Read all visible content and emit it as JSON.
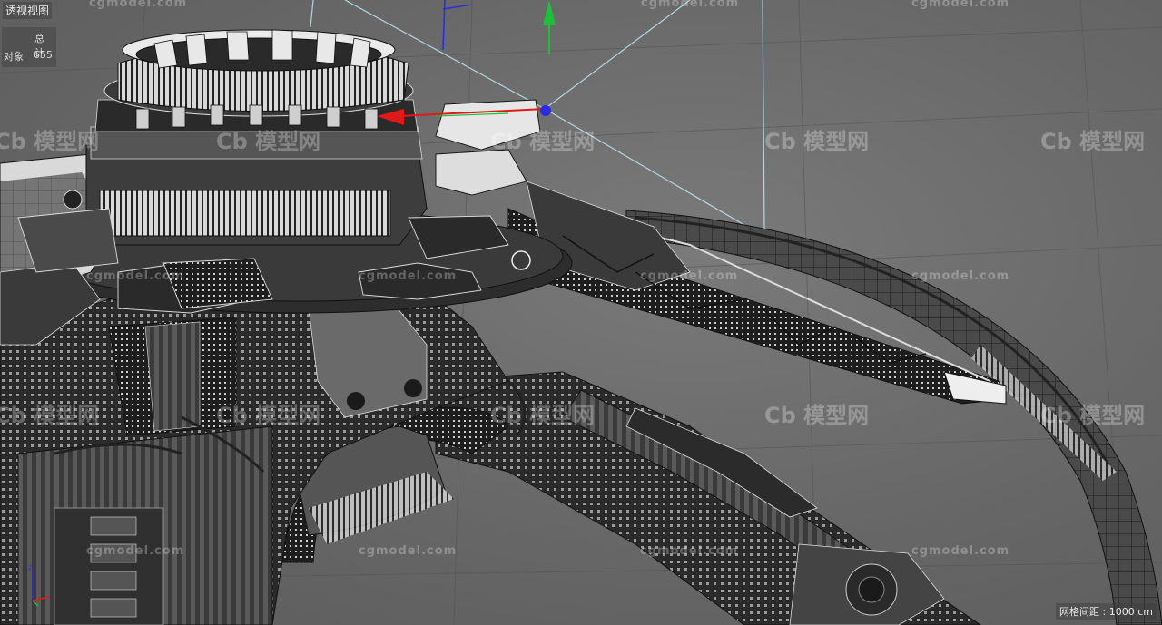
{
  "viewport": {
    "name": "透视视图",
    "stats": {
      "header": "总计",
      "objects_label": "对象",
      "objects_value": "655"
    },
    "grid_spacing": "网格间距 : 1000 cm"
  },
  "watermarks": {
    "text": "cgmodel.com",
    "logo": "模型网"
  },
  "colors": {
    "background": "#6b6b6b",
    "axis_x": "#e01a1a",
    "axis_y": "#1fbf3a",
    "axis_z": "#2a2ae0",
    "guide_lines": "#bfe8f0"
  }
}
